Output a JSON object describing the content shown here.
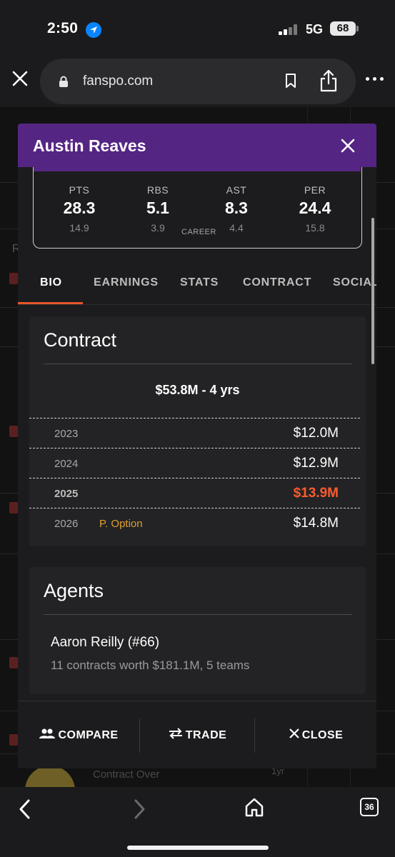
{
  "status_bar": {
    "time": "2:50",
    "network": "5G",
    "battery": "68"
  },
  "browser": {
    "url": "fanspo.com",
    "tab_count": "36"
  },
  "background": {
    "row_label": "R",
    "contract_over": "Contract Over",
    "yr_label": "1yr"
  },
  "modal": {
    "title": "Austin Reaves",
    "stats": [
      {
        "label": "PTS",
        "value": "28.3",
        "career": "14.9"
      },
      {
        "label": "RBS",
        "value": "5.1",
        "career": "3.9"
      },
      {
        "label": "AST",
        "value": "8.3",
        "career": "4.4"
      },
      {
        "label": "PER",
        "value": "24.4",
        "career": "15.8"
      }
    ],
    "career_label": "CAREER",
    "tabs": [
      "BIO",
      "EARNINGS",
      "STATS",
      "CONTRACT",
      "SOCIAL"
    ],
    "active_tab": "BIO",
    "contract": {
      "title": "Contract",
      "total": "$53.8M - 4 yrs",
      "rows": [
        {
          "year": "2023",
          "option": "",
          "amount": "$12.0M"
        },
        {
          "year": "2024",
          "option": "",
          "amount": "$12.9M"
        },
        {
          "year": "2025",
          "option": "",
          "amount": "$13.9M",
          "current": true
        },
        {
          "year": "2026",
          "option": "P. Option",
          "amount": "$14.8M"
        }
      ]
    },
    "agents": {
      "title": "Agents",
      "name": "Aaron Reilly (#66)",
      "detail": "11 contracts worth $181.1M, 5 teams"
    },
    "actions": {
      "compare": "COMPARE",
      "trade": "TRADE",
      "close": "CLOSE"
    }
  },
  "colors": {
    "header_purple": "#552583",
    "accent_orange": "#e8562a",
    "current_amount": "#ff5a2d",
    "option_gold": "#e0a030"
  }
}
